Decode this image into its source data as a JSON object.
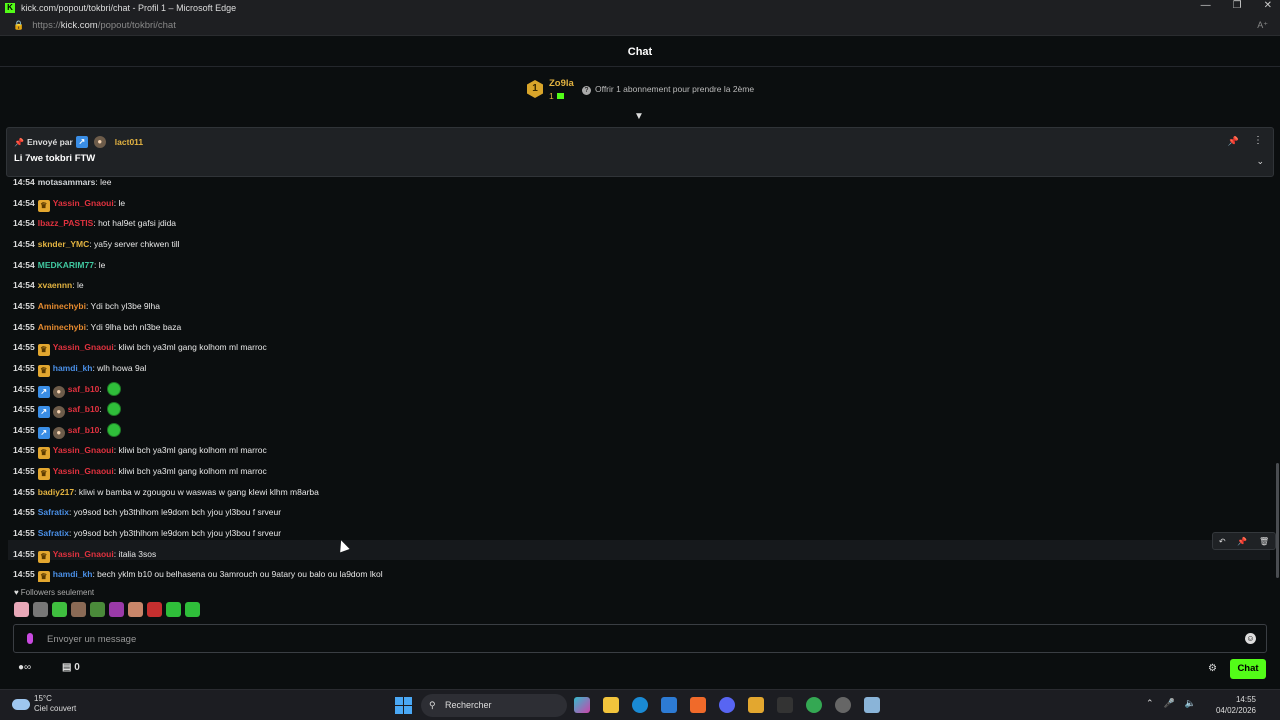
{
  "browser": {
    "window_title": "kick.com/popout/tokbri/chat - Profil 1 – Microsoft Edge",
    "url_prefix": "https://",
    "url_host": "kick.com",
    "url_path": "/popout/tokbri/chat"
  },
  "chat": {
    "header_title": "Chat",
    "leaderboard": {
      "rank": "1",
      "username": "Zo9la",
      "count": "1",
      "offer_text": "Offrir 1 abonnement pour prendre la 2ème"
    },
    "pinned": {
      "sent_by_label": "Envoyé par",
      "author": "lact011",
      "message": "Li 7we tokbri FTW"
    },
    "messages": [
      {
        "time": "14:54",
        "user": "motasammars",
        "color": "#cfd2d6",
        "badges": [],
        "text": "lee",
        "emote": false
      },
      {
        "time": "14:54",
        "user": "Yassin_Gnaoui",
        "color": "#e0323f",
        "badges": [
          "crown"
        ],
        "text": "le",
        "emote": false
      },
      {
        "time": "14:54",
        "user": "lbazz_PASTIS",
        "color": "#e0323f",
        "badges": [],
        "text": "hot hal9et gafsi jdida",
        "emote": false
      },
      {
        "time": "14:54",
        "user": "sknder_YMC",
        "color": "#e3b341",
        "badges": [],
        "text": "ya5y server chkwen till",
        "emote": false
      },
      {
        "time": "14:54",
        "user": "MEDKARIM77",
        "color": "#40c8a0",
        "badges": [],
        "text": "le",
        "emote": false
      },
      {
        "time": "14:54",
        "user": "xvaennn",
        "color": "#e3b341",
        "badges": [],
        "text": "le",
        "emote": false
      },
      {
        "time": "14:55",
        "user": "Aminechybi",
        "color": "#e58a2f",
        "badges": [],
        "text": "Ydi bch yl3be 9lha",
        "emote": false
      },
      {
        "time": "14:55",
        "user": "Aminechybi",
        "color": "#e58a2f",
        "badges": [],
        "text": "Ydi 9lha bch nl3be baza",
        "emote": false
      },
      {
        "time": "14:55",
        "user": "Yassin_Gnaoui",
        "color": "#e0323f",
        "badges": [
          "crown"
        ],
        "text": "kliwi bch ya3ml gang kolhom ml marroc",
        "emote": false
      },
      {
        "time": "14:55",
        "user": "hamdi_kh",
        "color": "#4a8fe6",
        "badges": [
          "crown"
        ],
        "text": "wlh howa 9al",
        "emote": false
      },
      {
        "time": "14:55",
        "user": "saf_b10",
        "color": "#e0323f",
        "badges": [
          "staff",
          "avatar"
        ],
        "text": "",
        "emote": true
      },
      {
        "time": "14:55",
        "user": "saf_b10",
        "color": "#e0323f",
        "badges": [
          "staff",
          "avatar"
        ],
        "text": "",
        "emote": true
      },
      {
        "time": "14:55",
        "user": "saf_b10",
        "color": "#e0323f",
        "badges": [
          "staff",
          "avatar"
        ],
        "text": "",
        "emote": true
      },
      {
        "time": "14:55",
        "user": "Yassin_Gnaoui",
        "color": "#e0323f",
        "badges": [
          "crown"
        ],
        "text": "kliwi bch ya3ml gang kolhom ml marroc",
        "emote": false
      },
      {
        "time": "14:55",
        "user": "Yassin_Gnaoui",
        "color": "#e0323f",
        "badges": [
          "crown"
        ],
        "text": "kliwi bch ya3ml gang kolhom ml marroc",
        "emote": false
      },
      {
        "time": "14:55",
        "user": "badiy217",
        "color": "#e3b341",
        "badges": [],
        "text": "kliwi w bamba w zgougou w waswas w gang klewi klhm m8arba",
        "emote": false
      },
      {
        "time": "14:55",
        "user": "Safratix",
        "color": "#4a8fe6",
        "badges": [],
        "text": "yo9sod bch yb3thlhom le9dom bch yjou yl3bou f srveur",
        "emote": false
      },
      {
        "time": "14:55",
        "user": "Safratix",
        "color": "#4a8fe6",
        "badges": [],
        "text": "yo9sod bch yb3thlhom le9dom bch yjou yl3bou f srveur",
        "emote": false
      },
      {
        "time": "14:55",
        "user": "Yassin_Gnaoui",
        "color": "#e0323f",
        "badges": [
          "crown"
        ],
        "text": "italia 3sos",
        "emote": false
      },
      {
        "time": "14:55",
        "user": "hamdi_kh",
        "color": "#4a8fe6",
        "badges": [
          "crown"
        ],
        "text": "bech yklm b10 ou belhasena ou 3amrouch ou 9atary ou balo ou la9dom lkol",
        "emote": false
      }
    ],
    "followers_only_label": "Followers seulement",
    "input_placeholder": "Envoyer un message",
    "points_count": "0",
    "send_label": "Chat"
  },
  "taskbar": {
    "temperature": "15°C",
    "weather_desc": "Ciel couvert",
    "search_label": "Rechercher",
    "time": "14:55",
    "date": "04/02/2026"
  },
  "colors": {
    "accent": "#53fc18",
    "background": "#0b0e0f"
  }
}
